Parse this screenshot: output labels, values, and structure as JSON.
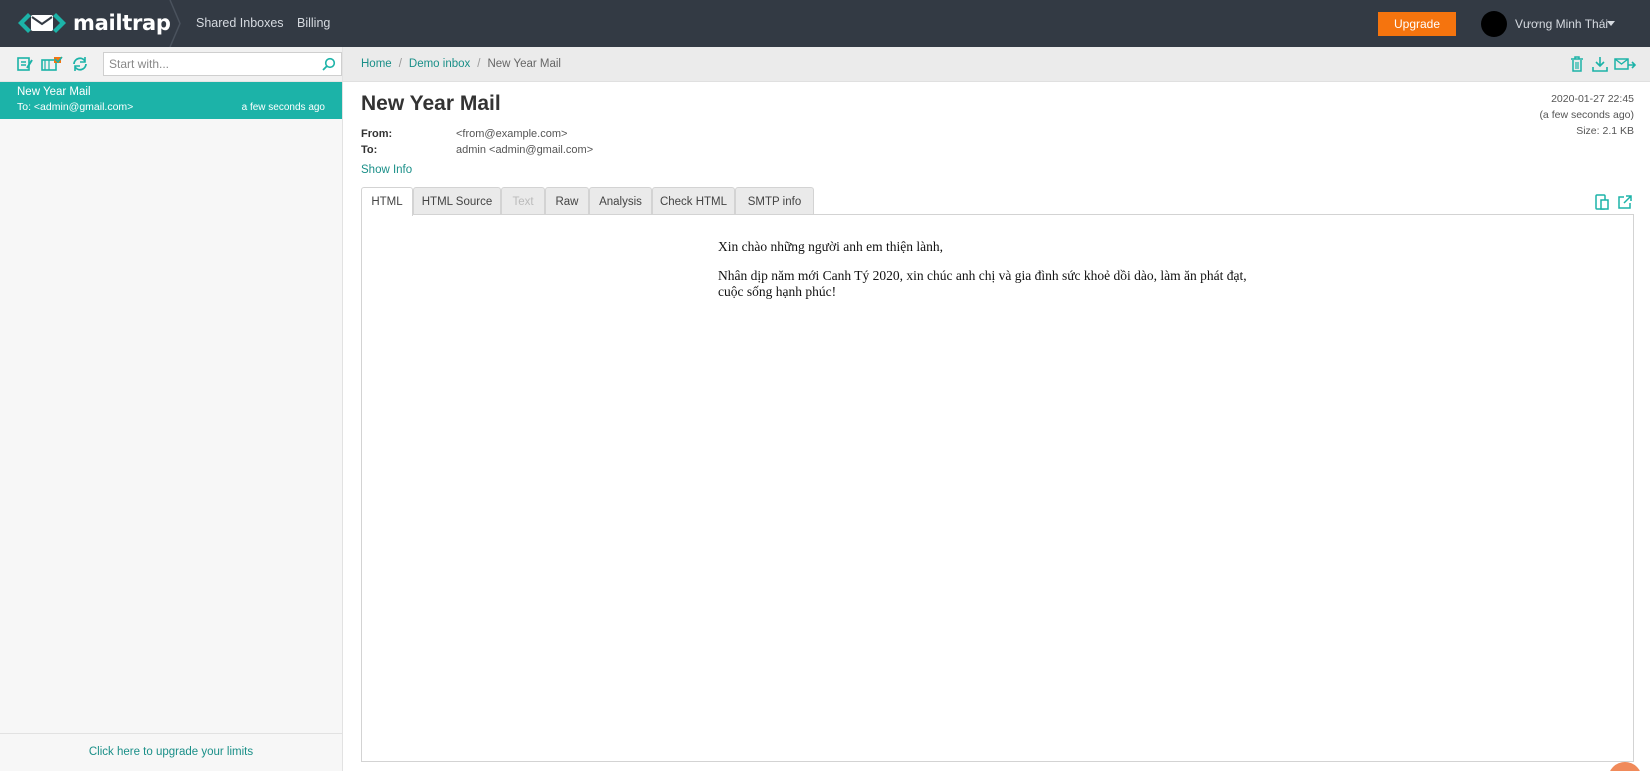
{
  "app": {
    "brand": "mailtrap"
  },
  "nav": {
    "shared_inboxes": "Shared Inboxes",
    "billing": "Billing"
  },
  "header": {
    "upgrade_label": "Upgrade",
    "user_name": "Vương Minh Thái"
  },
  "search": {
    "placeholder": "Start with..."
  },
  "inbox": {
    "messages": [
      {
        "subject": "New Year Mail",
        "to": "To: <admin@gmail.com>",
        "time": "a few seconds ago"
      }
    ],
    "footer_link": "Click here to upgrade your limits"
  },
  "breadcrumb": {
    "home": "Home",
    "inbox": "Demo inbox",
    "current": "New Year Mail"
  },
  "message": {
    "title": "New Year Mail",
    "date": "2020-01-27 22:45",
    "relative": "(a few seconds ago)",
    "size": "Size: 2.1 KB",
    "from_label": "From:",
    "from_value": "<from@example.com>",
    "to_label": "To:",
    "to_value": "admin <admin@gmail.com>",
    "show_info": "Show Info"
  },
  "tabs": [
    {
      "label": "HTML",
      "active": true
    },
    {
      "label": "HTML Source"
    },
    {
      "label": "Text",
      "disabled": true
    },
    {
      "label": "Raw"
    },
    {
      "label": "Analysis"
    },
    {
      "label": "Check HTML"
    },
    {
      "label": "SMTP info"
    }
  ],
  "body": {
    "greeting": "Xin chào những người anh em thiện lành,",
    "line1": "Nhân dịp năm mới Canh Tý 2020, xin chúc anh chị và gia đình sức khoẻ dồi dào, làm ăn phát đạt,",
    "line2": "cuộc sống hạnh phúc!"
  },
  "colors": {
    "accent": "#1cb3a8",
    "upgrade": "#f5740e",
    "topbar": "#333a44"
  },
  "icons": [
    "mail-logo-icon",
    "compose-icon",
    "mark-read-icon",
    "refresh-icon",
    "search-icon",
    "trash-icon",
    "download-icon",
    "forward-icon",
    "mobile-view-icon",
    "external-link-icon"
  ]
}
